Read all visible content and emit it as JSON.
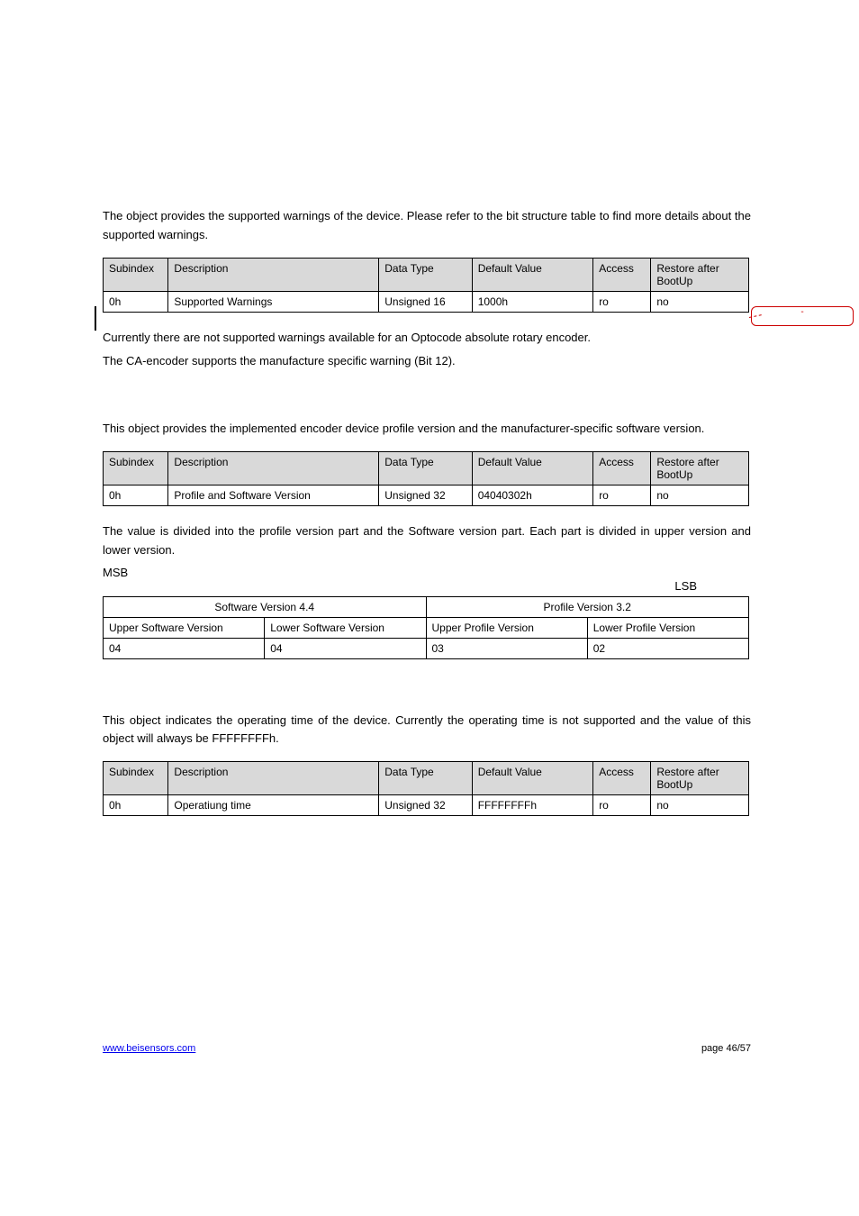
{
  "section1": {
    "intro": "The object provides the supported warnings of the device. Please refer to the bit structure table to find more details about the supported warnings.",
    "note1": "Currently there are not supported warnings available for an Optocode absolute rotary encoder.",
    "note2": "The CA-encoder supports the manufacture specific warning (Bit 12)."
  },
  "table_headers": {
    "subindex": "Subindex",
    "description": "Description",
    "data_type": "Data Type",
    "default_value": "Default Value",
    "access": "Access",
    "restore": "Restore after BootUp"
  },
  "table1": {
    "row": {
      "subindex": "0h",
      "description": "Supported Warnings",
      "data_type": "Unsigned 16",
      "default_value": "1000h",
      "access": "ro",
      "restore": "no"
    }
  },
  "section2": {
    "intro": "This object provides the implemented encoder device profile version and the manufacturer-specific software version.",
    "note": "The value is divided into the profile version part and the Software version part. Each part is divided in upper version and lower version.",
    "msb": "MSB",
    "lsb": "LSB"
  },
  "table2": {
    "row": {
      "subindex": "0h",
      "description": "Profile and Software Version",
      "data_type": "Unsigned 32",
      "default_value": "04040302h",
      "access": "ro",
      "restore": "no"
    }
  },
  "version_table": {
    "sw_header": "Software Version 4.4",
    "pv_header": "Profile Version 3.2",
    "usv": "Upper Software Version",
    "lsv": "Lower Software Version",
    "upv": "Upper Profile Version",
    "lpv": "Lower Profile Version",
    "v_usv": "04",
    "v_lsv": "04",
    "v_upv": "03",
    "v_lpv": "02"
  },
  "section3": {
    "intro": "This object indicates the operating time of the device. Currently the operating time is not supported and the value of this object will always be FFFFFFFFh."
  },
  "table3": {
    "row": {
      "subindex": "0h",
      "description": "Operatiung time",
      "data_type": "Unsigned 32",
      "default_value": "FFFFFFFFh",
      "access": "ro",
      "restore": "no"
    }
  },
  "footer": {
    "link": "www.beisensors.com",
    "page": "page 46/57"
  },
  "callout": {
    "text": "-"
  }
}
